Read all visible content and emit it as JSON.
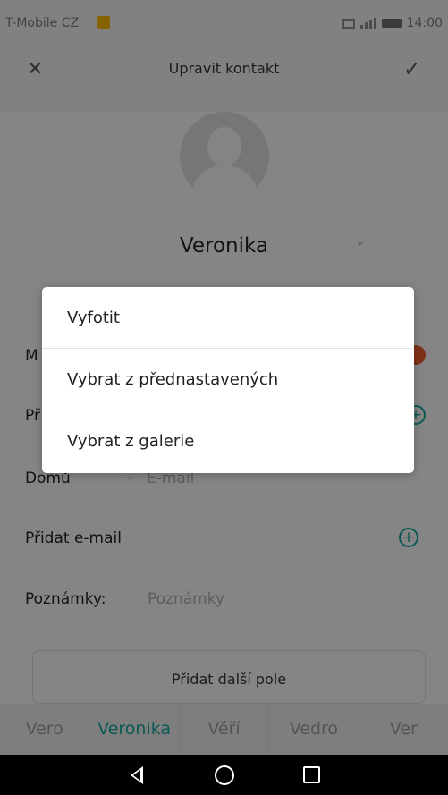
{
  "status_bar": {
    "carrier": "T-Mobile CZ",
    "time": "14:00"
  },
  "header": {
    "title": "Upravit kontakt",
    "close_icon": "close-icon",
    "confirm_icon": "check-icon"
  },
  "contact": {
    "name": "Veronika"
  },
  "fields": {
    "email_type": "Domů",
    "email_placeholder": "E-mail",
    "add_email": "Přidat e-mail",
    "notes_label": "Poznámky:",
    "notes_placeholder": "Poznámky",
    "partial_label_1": "M",
    "partial_label_2": "Př"
  },
  "add_field_button": "Přidat další pole",
  "suggestions": [
    "Vero",
    "Veronika",
    "Věří",
    "Vedro",
    "Ver"
  ],
  "dialog": {
    "options": [
      "Vyfotit",
      "Vybrat z přednastavených",
      "Vybrat z galerie"
    ]
  },
  "colors": {
    "accent": "#14a39a",
    "remove": "#e7582b"
  }
}
